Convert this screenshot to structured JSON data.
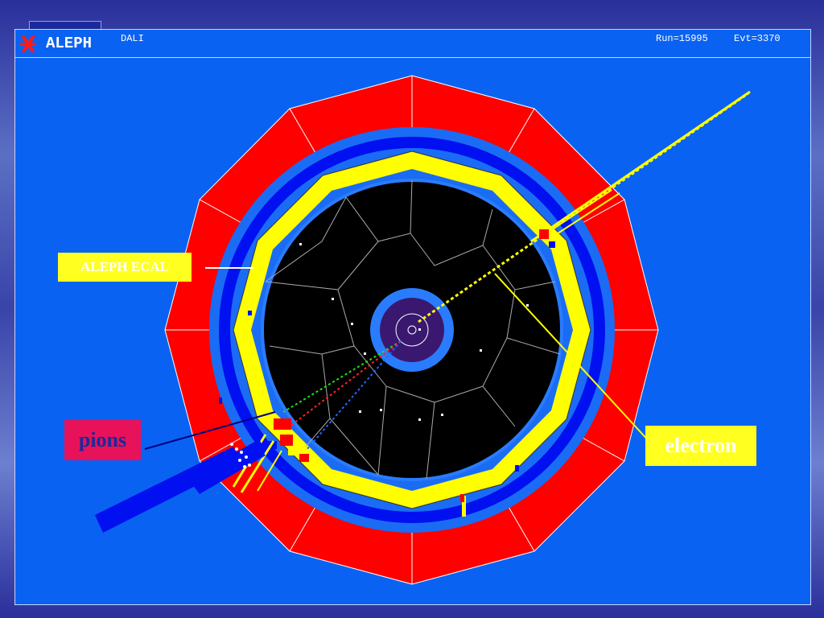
{
  "header": {
    "brand": "ALEPH",
    "subtitle": "DALI",
    "run": "Run=15995",
    "event": "Evt=3370"
  },
  "labels": {
    "ecal": "ALEPH ECAL",
    "pions": "pions",
    "electron": "electron"
  },
  "colors": {
    "panel_bg": "#0a62f2",
    "hcal": "#ff0000",
    "ecal": "#ffff00",
    "coil": "#0010f0",
    "tracker": "#000000",
    "vertex": "#3a1870",
    "pions_box": "#e8125a"
  },
  "icons": {
    "logo": "aleph-logo-icon"
  }
}
